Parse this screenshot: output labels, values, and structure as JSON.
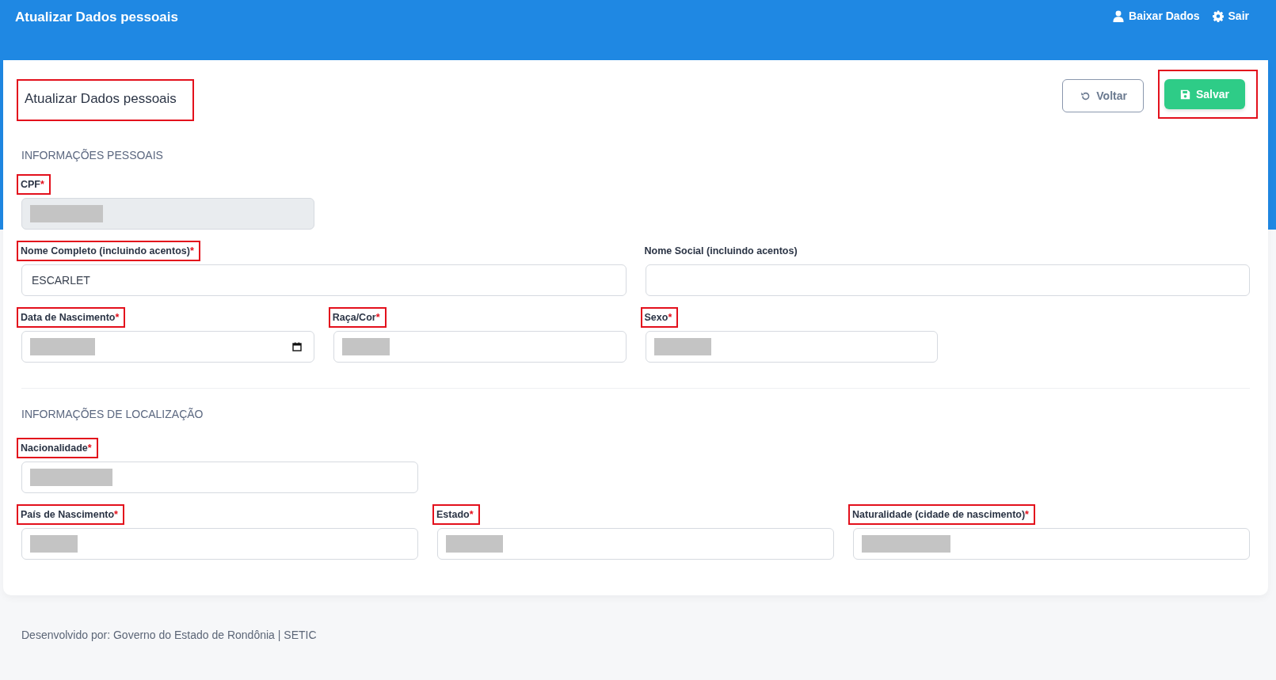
{
  "header": {
    "title": "Atualizar Dados pessoais",
    "actions": [
      {
        "label": "Baixar Dados"
      },
      {
        "label": "Sair"
      }
    ]
  },
  "card": {
    "title": "Atualizar Dados pessoais",
    "title_highlighted": true,
    "buttons": [
      {
        "label": "Voltar",
        "kind": "outline",
        "highlighted": false
      },
      {
        "label": "Salvar",
        "kind": "primary",
        "highlighted": true
      }
    ],
    "sections": [
      {
        "title": "INFORMAÇÕES PESSOAIS",
        "fields": [
          {
            "label": "CPF",
            "asterisk": "*",
            "highlighted": true,
            "kind": "text",
            "disabled": true,
            "redacted": true
          },
          {
            "label": "Nome Completo (incluindo acentos)",
            "asterisk": "*",
            "highlighted": true,
            "kind": "text",
            "disabled": false,
            "value": "ESCARLET"
          },
          {
            "label": "Nome Social (incluindo acentos)",
            "highlighted": false,
            "kind": "text",
            "disabled": false
          },
          {
            "label": "Data de Nascimento",
            "asterisk": "*",
            "highlighted": true,
            "kind": "date",
            "disabled": false,
            "redacted": true
          },
          {
            "label": "Raça/Cor",
            "asterisk": "*",
            "highlighted": true,
            "kind": "text",
            "disabled": false,
            "redacted": true
          },
          {
            "label": "Sexo",
            "asterisk": "*",
            "highlighted": true,
            "kind": "text",
            "disabled": false,
            "redacted": true
          }
        ]
      },
      {
        "title": "INFORMAÇÕES DE LOCALIZAÇÃO",
        "fields": [
          {
            "label": "Nacionalidade",
            "asterisk": "*",
            "highlighted": true,
            "kind": "text",
            "disabled": false,
            "redacted": true
          },
          {
            "label": "País de Nascimento",
            "asterisk": "*",
            "highlighted": true,
            "kind": "text",
            "disabled": false,
            "redacted": true
          },
          {
            "label": "Estado",
            "asterisk": "*",
            "highlighted": true,
            "kind": "text",
            "disabled": false,
            "redacted": true
          },
          {
            "label": "Naturalidade (cidade de nascimento)",
            "asterisk": "*",
            "highlighted": true,
            "kind": "text",
            "disabled": false,
            "redacted": true
          }
        ]
      }
    ]
  },
  "footer": {
    "text": "Desenvolvido por: Governo do Estado de Rondônia | SETIC"
  }
}
